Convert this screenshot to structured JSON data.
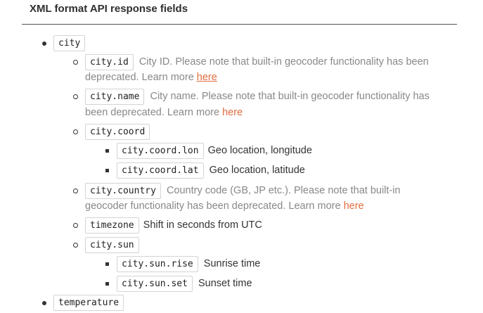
{
  "heading": "XML format API response fields",
  "items": {
    "city": {
      "code": "city"
    },
    "city_id": {
      "code": "city.id",
      "desc_line1": "City ID. Please note that built-in geocoder functionality has been",
      "desc_line2": "deprecated. Learn more",
      "link": "here"
    },
    "city_name": {
      "code": "city.name",
      "desc_line1": "City name. Please note that built-in geocoder functionality has",
      "desc_line2": "been deprecated. Learn more",
      "link": "here"
    },
    "city_coord": {
      "code": "city.coord"
    },
    "city_coord_lon": {
      "code": "city.coord.lon",
      "desc": "Geo location, longitude"
    },
    "city_coord_lat": {
      "code": "city.coord.lat",
      "desc": "Geo location, latitude"
    },
    "city_country": {
      "code": "city.country",
      "desc_line1": "Country code (GB, JP etc.). Please note that built-in",
      "desc_line2": "geocoder functionality has been deprecated. Learn more",
      "link": "here"
    },
    "timezone": {
      "code": "timezone",
      "desc": "Shift in seconds from UTC"
    },
    "city_sun": {
      "code": "city.sun"
    },
    "city_sun_rise": {
      "code": "city.sun.rise",
      "desc": "Sunrise time"
    },
    "city_sun_set": {
      "code": "city.sun.set",
      "desc": "Sunset time"
    },
    "temperature": {
      "code": "temperature"
    }
  }
}
